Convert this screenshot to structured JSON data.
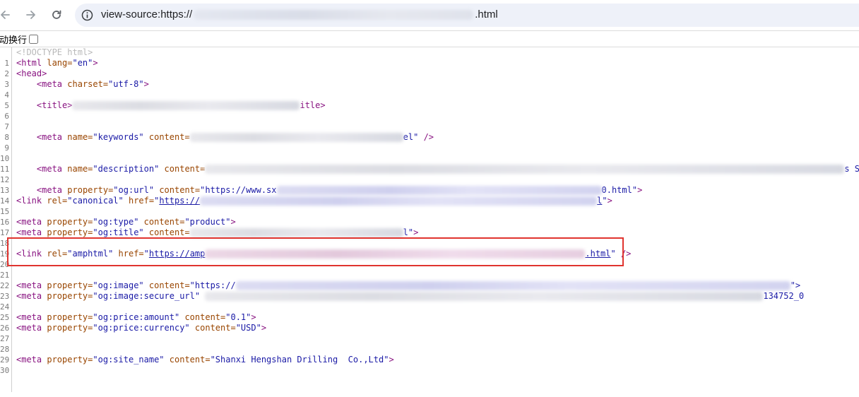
{
  "browser": {
    "url_prefix": "view-source:https://",
    "url_fragment": "genan-tz-ser",
    "url_suffix": ".html",
    "back_icon": "arrow-left-icon",
    "forward_icon": "arrow-right-icon",
    "reload_icon": "reload-icon",
    "info_icon": "info-icon"
  },
  "line_wrap": {
    "label": "动换行",
    "checked": false
  },
  "source_lines": [
    {
      "num": "1"
    },
    {
      "num": "2"
    },
    {
      "num": "3"
    },
    {
      "num": "4"
    },
    {
      "num": "5"
    },
    {
      "num": "6"
    },
    {
      "num": "7"
    },
    {
      "num": "8"
    },
    {
      "num": "9"
    },
    {
      "num": "10"
    },
    {
      "num": "11"
    },
    {
      "num": "12"
    },
    {
      "num": "13"
    },
    {
      "num": "14"
    },
    {
      "num": "15"
    },
    {
      "num": "16"
    },
    {
      "num": "17"
    },
    {
      "num": "18"
    },
    {
      "num": "19"
    },
    {
      "num": "20"
    },
    {
      "num": "21"
    },
    {
      "num": "22"
    },
    {
      "num": "23"
    },
    {
      "num": "24"
    },
    {
      "num": "25"
    },
    {
      "num": "26"
    },
    {
      "num": "27"
    },
    {
      "num": "28"
    },
    {
      "num": "29"
    },
    {
      "num": "30"
    }
  ],
  "code": {
    "doctype": "<!DOCTYPE html>",
    "html_open": "<html ",
    "lang_attr": "lang=",
    "lang_val": "\"en\"",
    "gt": ">",
    "head_open": "<head>",
    "meta_open": "<meta ",
    "charset_attr": "charset=",
    "charset_val": "\"utf-8\"",
    "title_open": "<title>",
    "title_close_tail": "itle>",
    "name_attr": "name=",
    "keywords_val": "\"keywords\"",
    "content_attr": "content=",
    "keywords_tail": "el\"",
    "self_close": " />",
    "description_val": "\"description\"",
    "description_text": "\"      shopping for Hengshan T2 Series Tri",
    "description_end": "s S",
    "property_attr": "property=",
    "og_url_val": "\"og:url\"",
    "og_url_content": "\"https://www.sx",
    "og_url_tail": "0.html\"",
    "link_open": "<link ",
    "rel_attr": "rel=",
    "canonical_val": "\"canonical\"",
    "href_attr": "href=",
    "canonical_href_start": "https://",
    "canonical_href_end": "l",
    "og_type_val": "\"og:type\"",
    "og_type_content": "\"product\"",
    "og_title_val": "\"og:title\"",
    "og_title_content": "\"          Series Tripl",
    "og_title_tail": "l\"",
    "amphtml_val": "\"amphtml\"",
    "amp_href_start": "https://amp",
    "amp_href_end": ".html",
    "og_image_val": "\"og:image\"",
    "og_image_content": "\"https://",
    "og_image_tail": "\">",
    "og_image_secure_val": "\"og:image:secure_url\"",
    "og_image_secure_content": "content= https:/",
    "og_image_secure_tail": "134752_0",
    "og_price_amount_val": "\"og:price:amount\"",
    "og_price_amount_content": "\"0.1\"",
    "og_price_currency_val": "\"og:price:currency\"",
    "og_price_currency_content": "\"USD\"",
    "og_site_name_val": "\"og:site_name\"",
    "og_site_name_content": "\"Shanxi Hengshan Drilling  Co.,Ltd\""
  },
  "colors": {
    "tag": "#881280",
    "attr_name": "#994500",
    "attr_value": "#1a1aa6",
    "comment": "#b9b9b9",
    "highlight_border": "#e0342f"
  }
}
